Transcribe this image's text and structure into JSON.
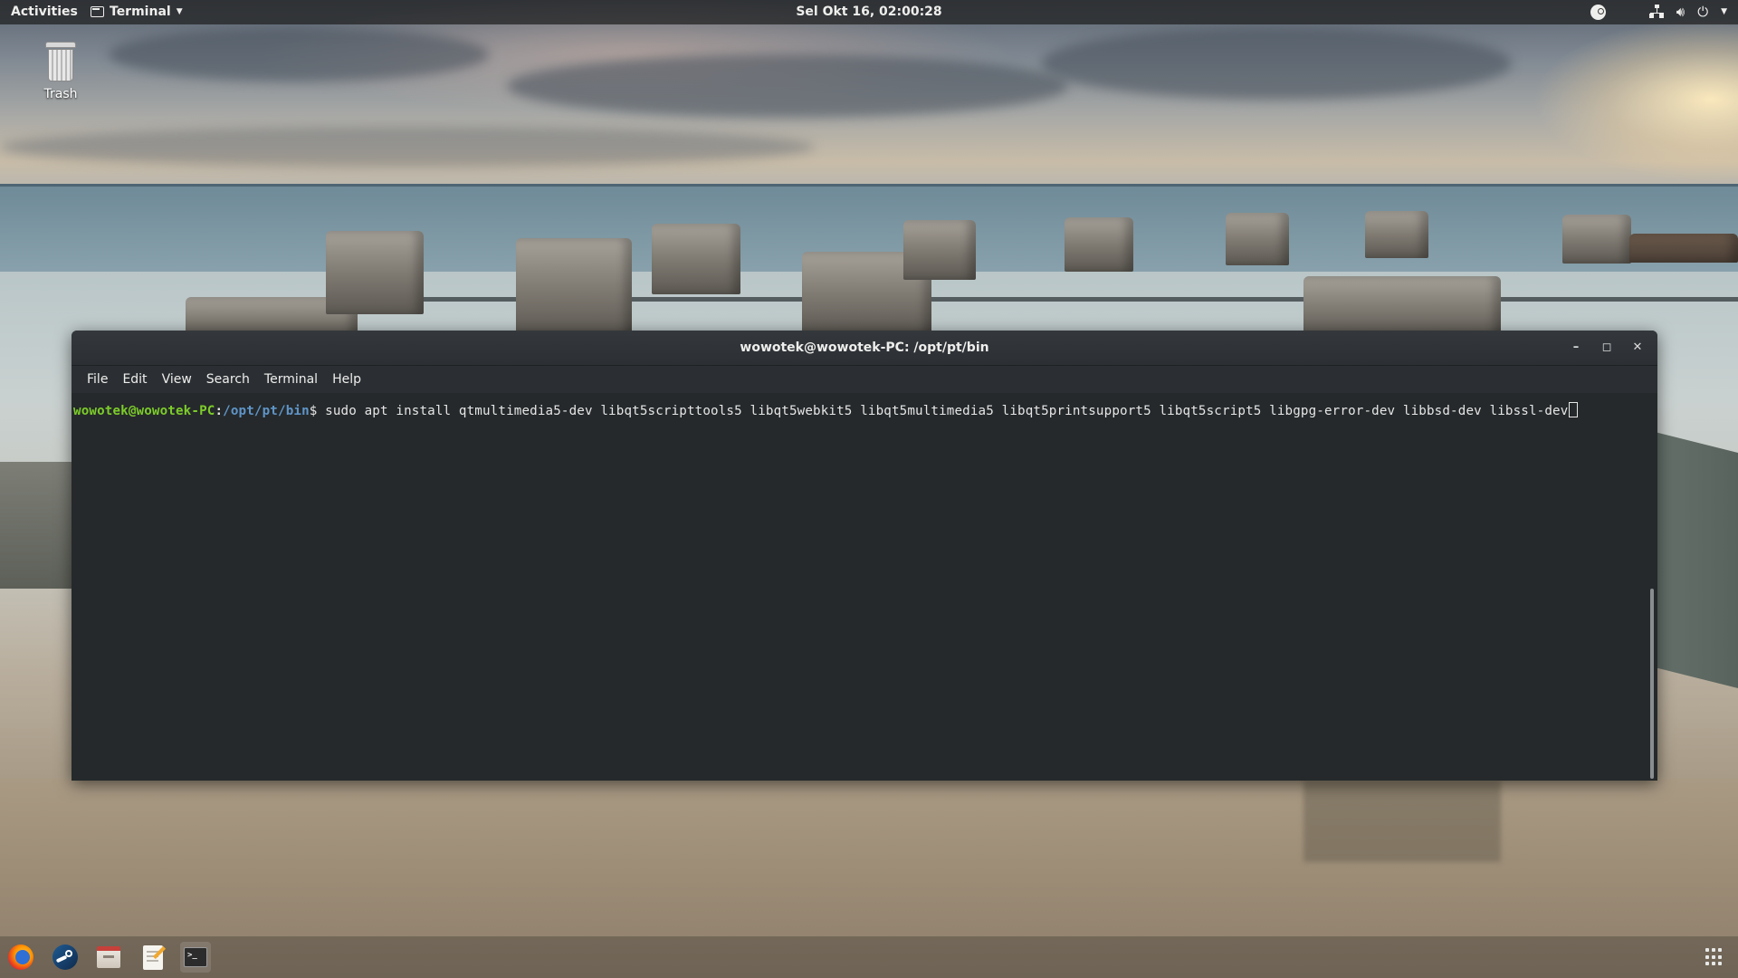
{
  "topbar": {
    "activities": "Activities",
    "app_menu": "Terminal",
    "clock": "Sel Okt 16, 02:00:28"
  },
  "desktop": {
    "icons": [
      {
        "label": "Trash",
        "icon": "trash-icon"
      }
    ]
  },
  "window": {
    "title": "wowotek@wowotek-PC: /opt/pt/bin",
    "controls": [
      "minimize",
      "maximize",
      "close"
    ],
    "menu": [
      "File",
      "Edit",
      "View",
      "Search",
      "Terminal",
      "Help"
    ],
    "prompt": {
      "user_host": "wowotek@wowotek-PC",
      "separator": ":",
      "path": "/opt/pt/bin",
      "symbol": "$",
      "command": " sudo apt install qtmultimedia5-dev libqt5scripttools5 libqt5webkit5 libqt5multimedia5 libqt5printsupport5 libqt5script5 libgpg-error-dev libbsd-dev libssl-dev"
    },
    "colors": {
      "background": "#25292b",
      "user_host": "#7ccc2a",
      "path": "#5f95c8",
      "text": "#e6e6e6"
    }
  },
  "dock": {
    "items": [
      "firefox-icon",
      "steam-icon",
      "file-manager-icon",
      "text-editor-icon",
      "terminal-icon"
    ],
    "active": "terminal-icon",
    "apps_button": "show-applications-icon"
  }
}
